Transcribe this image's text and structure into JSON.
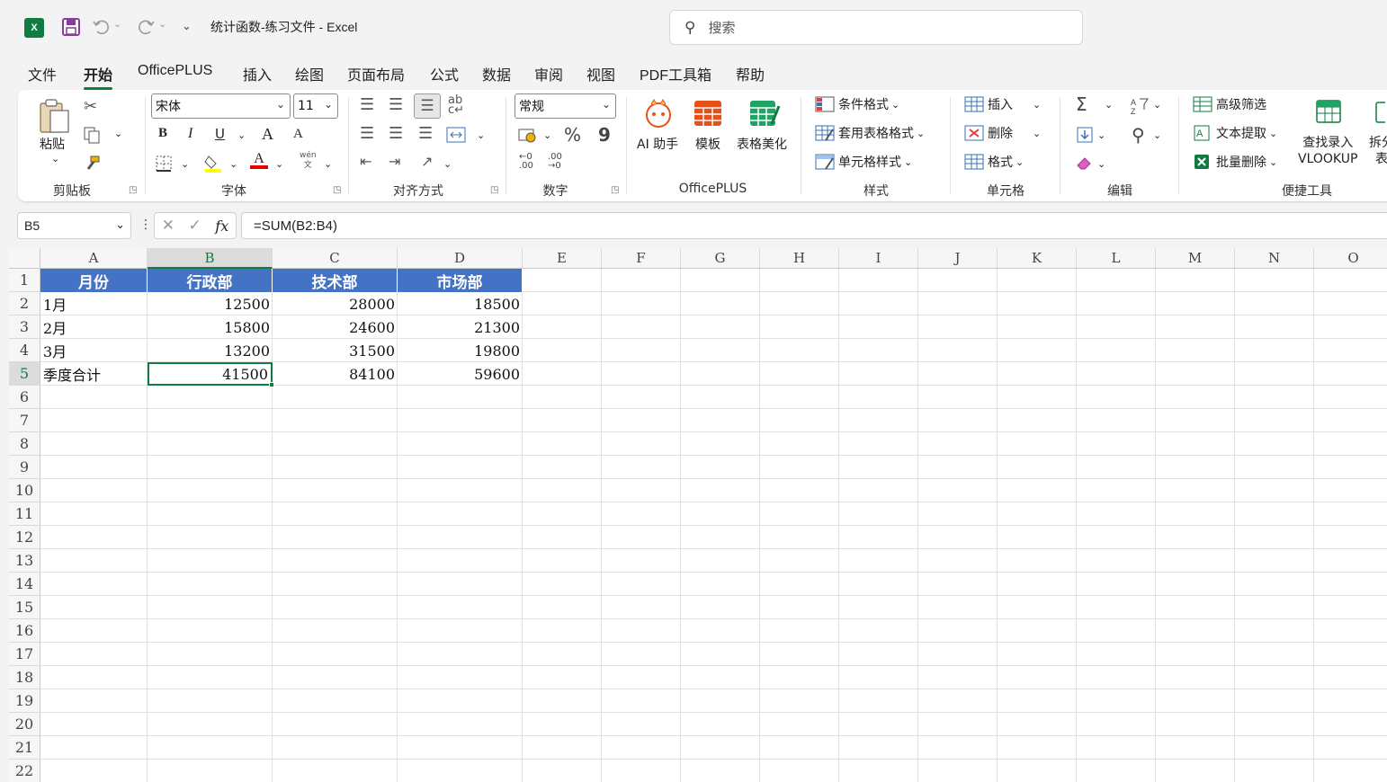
{
  "title_bar": {
    "doc_title": "统计函数-练习文件  -  Excel",
    "search_placeholder": "搜索",
    "icons": [
      "excel-logo",
      "save-icon",
      "undo-icon",
      "redo-icon",
      "customize-icon",
      "search-icon"
    ]
  },
  "menu_tabs": [
    "文件",
    "开始",
    "OfficePLUS",
    "插入",
    "绘图",
    "页面布局",
    "公式",
    "数据",
    "审阅",
    "视图",
    "PDF工具箱",
    "帮助"
  ],
  "active_tab": "开始",
  "ribbon": {
    "clipboard": {
      "label": "剪贴板",
      "paste": "粘贴"
    },
    "font": {
      "label": "字体",
      "font_name": "宋体",
      "font_size": "11",
      "bold": "B",
      "italic": "I",
      "underline": "U",
      "grow": "A",
      "shrink": "A",
      "pinyin": "wén"
    },
    "alignment": {
      "label": "对齐方式"
    },
    "number": {
      "label": "数字",
      "format": "常规",
      "percent": "%",
      "comma": "9",
      "inc_decimal": "←0 .00",
      "dec_decimal": ".00 →0"
    },
    "officeplus": {
      "label": "OfficePLUS",
      "ai": "AI 助手",
      "template": "模板",
      "beautify": "表格美化"
    },
    "styles": {
      "label": "样式",
      "conditional": "条件格式",
      "table_format": "套用表格格式",
      "cell_style": "单元格样式"
    },
    "cells": {
      "label": "单元格",
      "insert": "插入",
      "delete": "删除",
      "format": "格式"
    },
    "editing": {
      "label": "编辑"
    },
    "quick_tools": {
      "label": "便捷工具",
      "advanced_filter": "高级筛选",
      "text_extract": "文本提取",
      "batch_delete": "批量删除",
      "lookup_line1": "查找录入",
      "lookup_line2": "VLOOKUP",
      "split_line1": "拆分",
      "split_line2": "表"
    }
  },
  "formula_bar": {
    "name_box": "B5",
    "formula": "=SUM(B2:B4)",
    "fx": "fx"
  },
  "sheet": {
    "columns": [
      "A",
      "B",
      "C",
      "D",
      "E",
      "F",
      "G",
      "H",
      "I",
      "J",
      "K",
      "L",
      "M",
      "N",
      "O"
    ],
    "rows": [
      "1",
      "2",
      "3",
      "4",
      "5",
      "6",
      "7",
      "8",
      "9",
      "10",
      "11",
      "12",
      "13",
      "14",
      "15",
      "16",
      "17",
      "18",
      "19",
      "20",
      "21",
      "22"
    ],
    "selected_cell": "B5",
    "header": [
      "月份",
      "行政部",
      "技术部",
      "市场部"
    ],
    "data": [
      [
        "1月",
        "12500",
        "28000",
        "18500"
      ],
      [
        "2月",
        "15800",
        "24600",
        "21300"
      ],
      [
        "3月",
        "13200",
        "31500",
        "19800"
      ],
      [
        "季度合计",
        "41500",
        "84100",
        "59600"
      ]
    ],
    "colors": {
      "header_fill": "#4472c4",
      "header_text": "#ffffff",
      "selection": "#107c41"
    }
  }
}
